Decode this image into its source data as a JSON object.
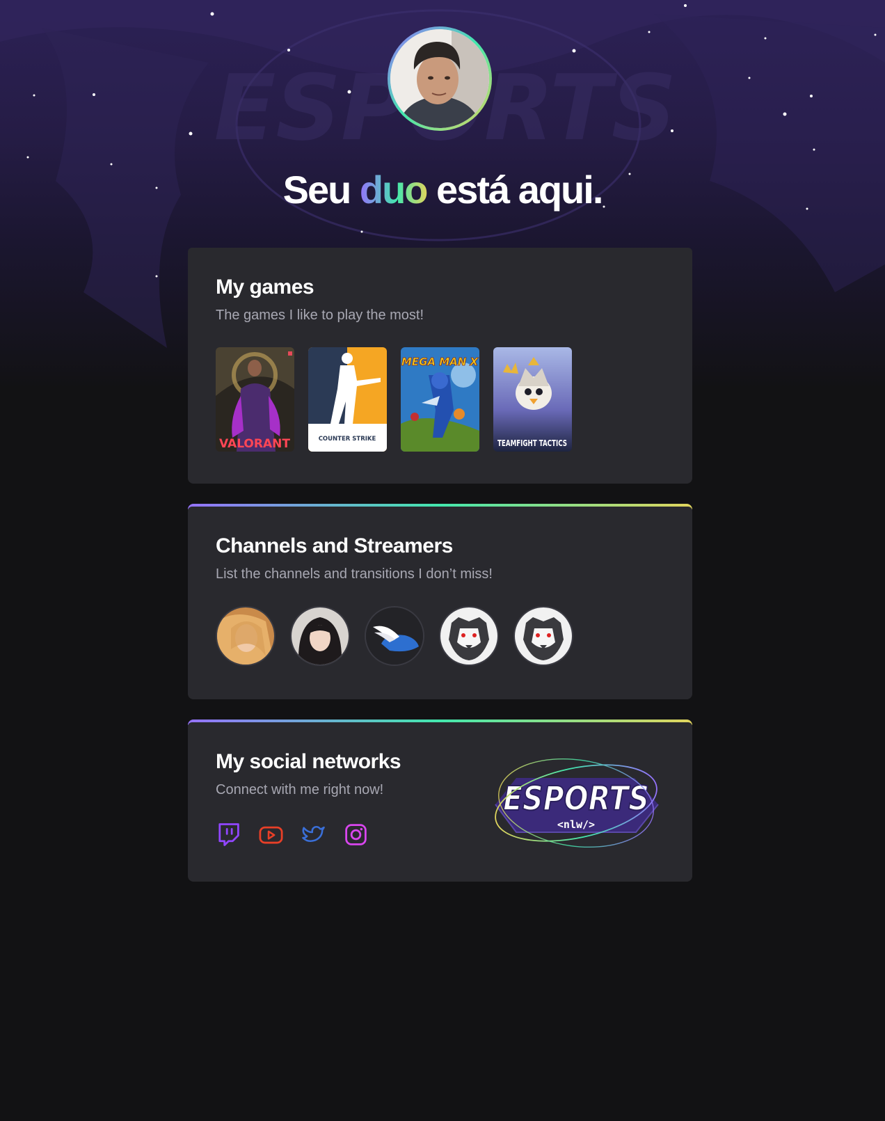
{
  "hero": {
    "headline_start": "Seu ",
    "headline_highlight": "duo",
    "headline_end": " está aqui.",
    "background_watermark": "ESPORTS",
    "avatar_icon": "profile-photo"
  },
  "games_section": {
    "title": "My games",
    "subtitle": "The games I like to play the most!",
    "games": [
      {
        "name": "VALORANT",
        "icon": "valorant-cover"
      },
      {
        "name": "COUNTER STRIKE",
        "icon": "counter-strike-cover"
      },
      {
        "name": "MEGA MAN X",
        "icon": "mega-man-x-cover"
      },
      {
        "name": "TEAMFIGHT TACTICS",
        "icon": "teamfight-tactics-cover"
      }
    ]
  },
  "streamers_section": {
    "title": "Channels and Streamers",
    "subtitle": "List the channels and transitions I don’t miss!",
    "streamers": [
      {
        "icon": "streamer-avatar-blonde"
      },
      {
        "icon": "streamer-avatar-dark-hair"
      },
      {
        "icon": "winged-helmet-logo"
      },
      {
        "icon": "tiger-logo"
      },
      {
        "icon": "tiger-logo"
      }
    ]
  },
  "social_section": {
    "title": "My social networks",
    "subtitle": "Connect with me right now!",
    "networks": [
      {
        "name": "twitch",
        "icon": "twitch-icon",
        "color": "#9146ff"
      },
      {
        "name": "youtube",
        "icon": "youtube-icon",
        "color": "#e83f27"
      },
      {
        "name": "twitter",
        "icon": "twitter-icon",
        "color": "#3a6fd8"
      },
      {
        "name": "instagram",
        "icon": "instagram-icon",
        "color": "#d946ef"
      }
    ],
    "logo_text": "ESPORTS",
    "logo_subtext": "<nlw/>"
  },
  "colors": {
    "background": "#121214",
    "card": "#29292e",
    "gradient_start": "#9572fc",
    "gradient_mid": "#43e7ad",
    "gradient_end": "#e1d55d",
    "muted_text": "#a8a8b3"
  }
}
